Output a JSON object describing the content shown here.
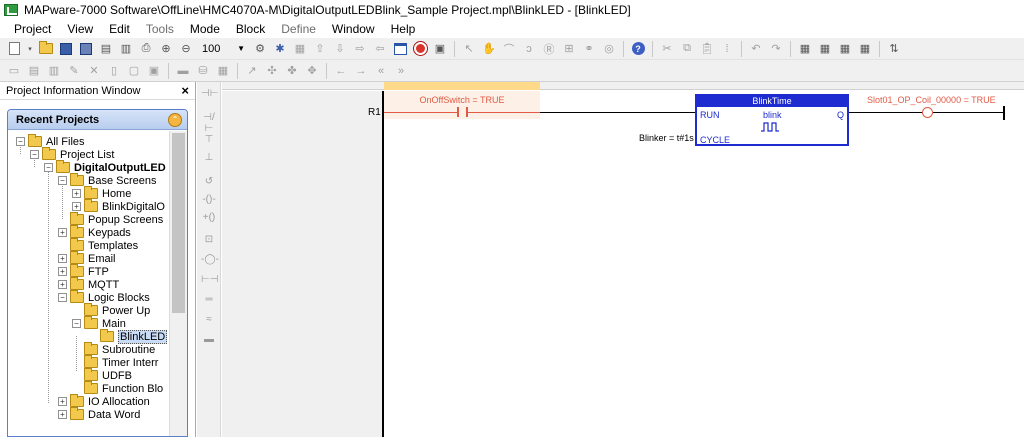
{
  "window": {
    "title": "MAPware-7000 Software\\OffLine\\HMC4070A-M\\DigitalOutputLEDBlink_Sample Project.mpl\\BlinkLED - [BlinkLED]"
  },
  "menu": {
    "items": [
      {
        "label": "Project",
        "enabled": true
      },
      {
        "label": "View",
        "enabled": true
      },
      {
        "label": "Edit",
        "enabled": true
      },
      {
        "label": "Tools",
        "enabled": false
      },
      {
        "label": "Mode",
        "enabled": true
      },
      {
        "label": "Block",
        "enabled": true
      },
      {
        "label": "Define",
        "enabled": false
      },
      {
        "label": "Window",
        "enabled": true
      },
      {
        "label": "Help",
        "enabled": true
      }
    ]
  },
  "toolbar": {
    "zoom_value": "100"
  },
  "project_panel": {
    "title": "Project Information Window",
    "close_glyph": "×",
    "recent_projects_title": "Recent Projects",
    "tree": [
      {
        "label": "All Files",
        "expander": "-"
      },
      {
        "label": "Project List",
        "expander": "-"
      },
      {
        "label": "DigitalOutputLED",
        "expander": "-"
      },
      {
        "label": "Base Screens",
        "expander": "-"
      },
      {
        "label": "Home",
        "expander": "+"
      },
      {
        "label": "BlinkDigitalO",
        "expander": "+"
      },
      {
        "label": "Popup Screens",
        "expander": ""
      },
      {
        "label": "Keypads",
        "expander": "+"
      },
      {
        "label": "Templates",
        "expander": ""
      },
      {
        "label": "Email",
        "expander": "+"
      },
      {
        "label": "FTP",
        "expander": "+"
      },
      {
        "label": "MQTT",
        "expander": "+"
      },
      {
        "label": "Logic Blocks",
        "expander": "-"
      },
      {
        "label": "Power Up",
        "expander": ""
      },
      {
        "label": "Main",
        "expander": "-"
      },
      {
        "label": "BlinkLED",
        "expander": ""
      },
      {
        "label": "Subroutine",
        "expander": ""
      },
      {
        "label": "Timer Interr",
        "expander": ""
      },
      {
        "label": "UDFB",
        "expander": ""
      },
      {
        "label": "Function Blo",
        "expander": ""
      },
      {
        "label": "IO Allocation",
        "expander": "+"
      },
      {
        "label": "Data Word",
        "expander": "+"
      }
    ]
  },
  "ladder": {
    "rung_label": "R1",
    "contact_label": "OnOffSwitch = TRUE",
    "function_block": {
      "title": "BlinkTime",
      "input_run": "RUN",
      "name": "blink",
      "output_q": "Q",
      "input_cycle": "CYCLE"
    },
    "blinker_param": "Blinker = t#1s",
    "coil_label": "Slot01_OP_Coil_00000 = TRUE"
  },
  "colors": {
    "active_element": "#e15a45",
    "function_block": "#1d2bd0",
    "contact_highlight": "#fdf0e6"
  }
}
